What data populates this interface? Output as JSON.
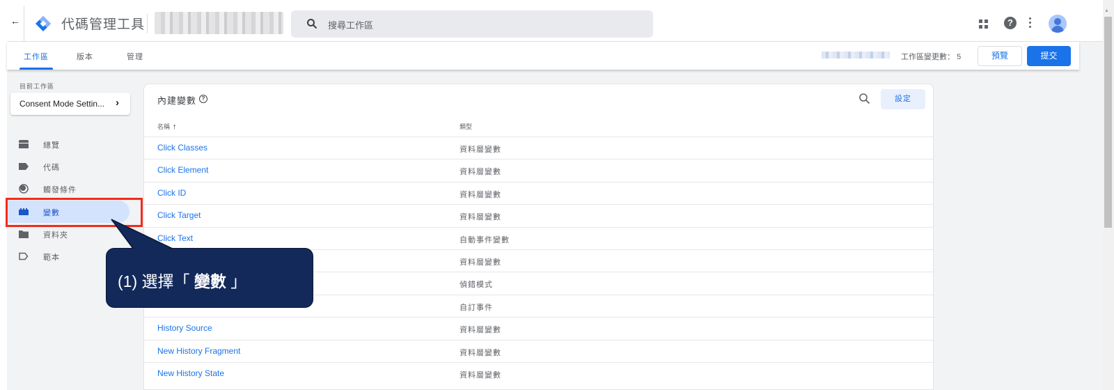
{
  "header": {
    "back_label": "←",
    "app_title": "代碼管理工具",
    "account_name_blurred": true,
    "search_placeholder": "搜尋工作區",
    "help_glyph": "?"
  },
  "subnav": {
    "tabs": [
      {
        "label": "工作區",
        "active": true
      },
      {
        "label": "版本",
        "active": false
      },
      {
        "label": "管理",
        "active": false
      }
    ],
    "workspace_changes_label": "工作區變更數：",
    "workspace_changes_count": "5",
    "preview_label": "預覽",
    "submit_label": "提交"
  },
  "sidebar": {
    "current_workspace_label": "目前工作區",
    "current_workspace_name": "Consent Mode Settin...",
    "chevron": "›",
    "items": [
      {
        "label": "總覽",
        "icon": "overview-icon",
        "active": false
      },
      {
        "label": "代碼",
        "icon": "tag-icon",
        "active": false
      },
      {
        "label": "觸發條件",
        "icon": "trigger-icon",
        "active": false
      },
      {
        "label": "變數",
        "icon": "variable-icon",
        "active": true
      },
      {
        "label": "資料夾",
        "icon": "folder-icon",
        "active": false
      },
      {
        "label": "範本",
        "icon": "template-icon",
        "active": false
      }
    ]
  },
  "card": {
    "title": "內建變數",
    "help_glyph": "?",
    "settings_label": "設定",
    "columns": {
      "name": "名稱",
      "sort_arrow": "↑",
      "type": "類型"
    },
    "rows": [
      {
        "name": "Click Classes",
        "type": "資料層變數"
      },
      {
        "name": "Click Element",
        "type": "資料層變數"
      },
      {
        "name": "Click ID",
        "type": "資料層變數"
      },
      {
        "name": "Click Target",
        "type": "資料層變數"
      },
      {
        "name": "Click Text",
        "type": "自動事件變數"
      },
      {
        "name": "",
        "type": "資料層變數"
      },
      {
        "name": "",
        "type": "偵錯模式"
      },
      {
        "name": "",
        "type": "自訂事件"
      },
      {
        "name": "History Source",
        "type": "資料層變數"
      },
      {
        "name": "New History Fragment",
        "type": "資料層變數"
      },
      {
        "name": "New History State",
        "type": "資料層變數"
      }
    ]
  },
  "annotation": {
    "prefix": "(1) 選擇「 ",
    "emphasis": "變數",
    "suffix": " 」",
    "box_color": "#f22b1b",
    "callout_color": "#13295a"
  },
  "colors": {
    "accent": "#1a73e8",
    "active_nav_bg": "#d3e3fd"
  }
}
